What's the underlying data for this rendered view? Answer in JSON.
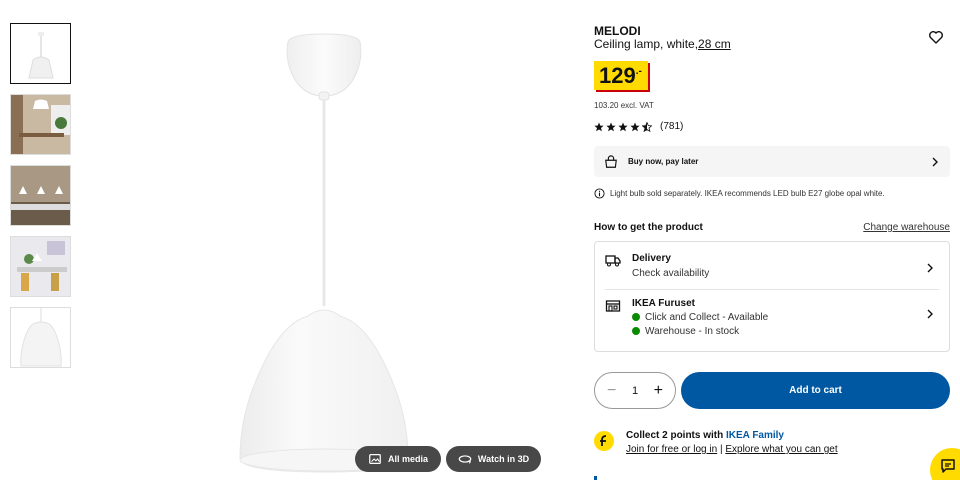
{
  "product": {
    "name": "MELODI",
    "description": "Ceiling lamp, white,",
    "size_link": "28 cm",
    "price_int": "129",
    "price_dec": ".-",
    "excl_vat": "103.20 excl. VAT",
    "rating_value": 4.5,
    "rating_count": "(781)"
  },
  "buy_now": {
    "label": "Buy now, pay later"
  },
  "bulb_note": "Light bulb sold separately. IKEA recommends LED bulb E27 globe opal white.",
  "fulfilment": {
    "heading": "How to get the product",
    "change_warehouse": "Change warehouse",
    "delivery": {
      "title": "Delivery",
      "subtitle": "Check availability"
    },
    "store": {
      "title": "IKEA Furuset",
      "lines": [
        "Click and Collect - Available",
        "Warehouse - In stock"
      ]
    }
  },
  "cart": {
    "quantity": "1",
    "minus": "−",
    "plus": "+",
    "add_label": "Add to cart"
  },
  "family": {
    "line1_prefix": "Collect 2 points with ",
    "line1_brand": "IKEA Family",
    "join_link": "Join for free or log in",
    "separator": "|",
    "explore_link": "Explore what you can get"
  },
  "media": {
    "all_media": "All media",
    "watch_3d": "Watch in 3D"
  },
  "colors": {
    "accent_blue": "#0058a3",
    "price_yellow": "#ffdb00",
    "price_red": "#cc0008",
    "stock_green": "#0a8a00"
  },
  "icons": [
    "heart-icon",
    "shopping-bag-icon",
    "info-icon",
    "truck-icon",
    "store-icon",
    "chevron-right-icon",
    "gallery-icon",
    "rotate-3d-icon",
    "chat-icon"
  ]
}
